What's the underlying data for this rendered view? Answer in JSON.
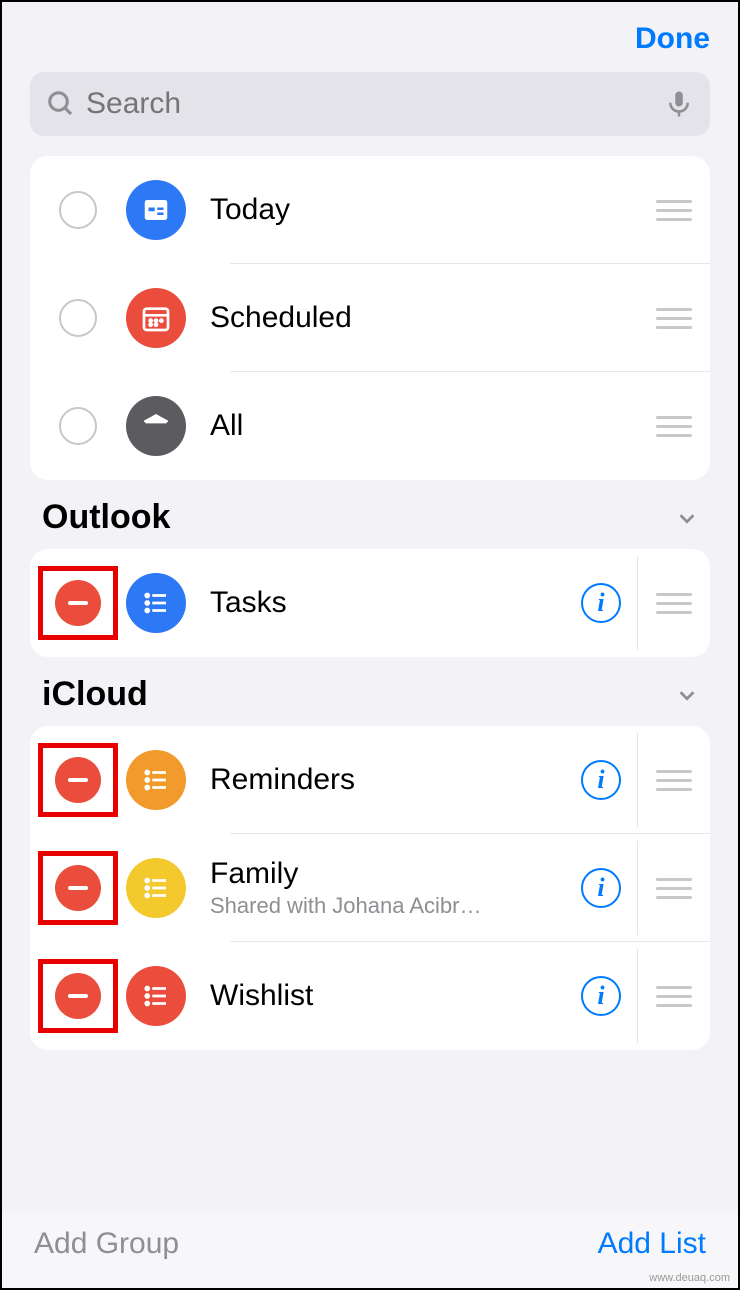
{
  "topbar": {
    "done": "Done"
  },
  "search": {
    "placeholder": "Search"
  },
  "smartLists": [
    {
      "label": "Today"
    },
    {
      "label": "Scheduled"
    },
    {
      "label": "All"
    }
  ],
  "sections": {
    "outlook": {
      "title": "Outlook",
      "lists": [
        {
          "label": "Tasks"
        }
      ]
    },
    "icloud": {
      "title": "iCloud",
      "lists": [
        {
          "label": "Reminders"
        },
        {
          "label": "Family",
          "sub": "Shared with Johana Acibr…"
        },
        {
          "label": "Wishlist"
        }
      ]
    }
  },
  "footer": {
    "addGroup": "Add Group",
    "addList": "Add List"
  },
  "watermark": "www.deuaq.com"
}
